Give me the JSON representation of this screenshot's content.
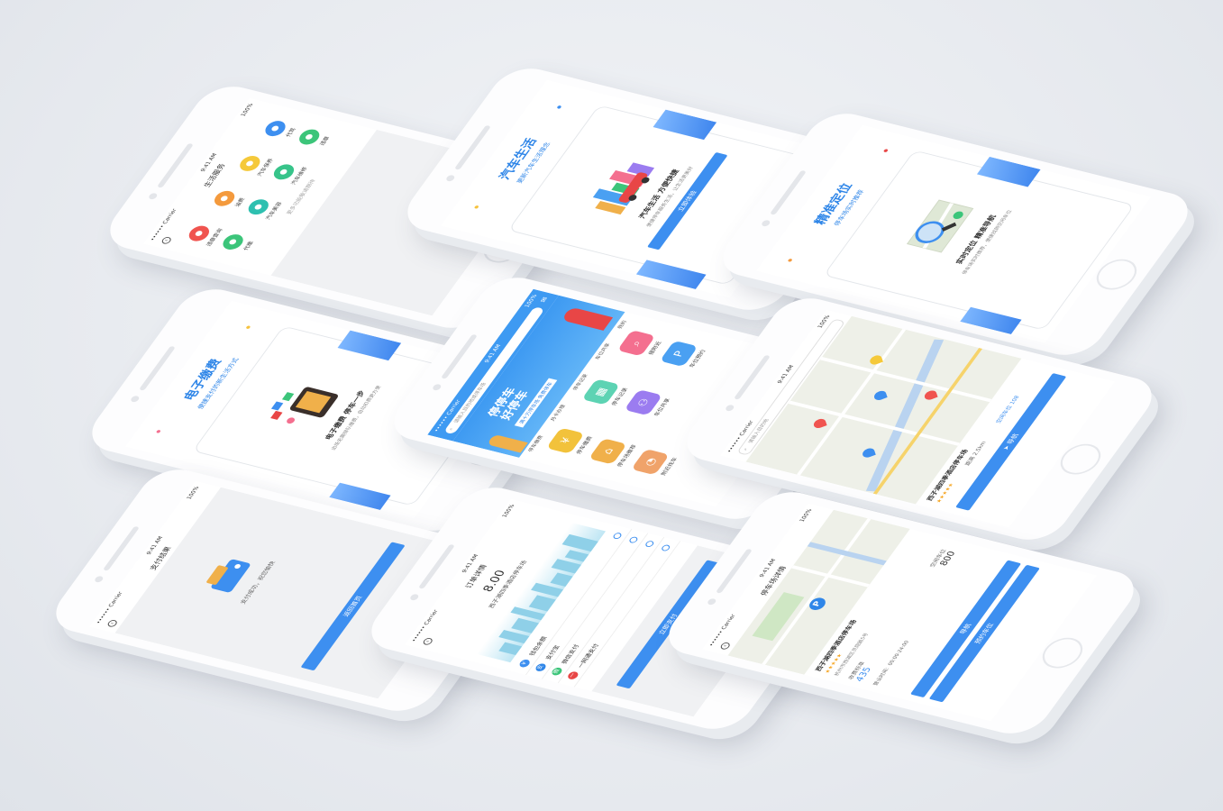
{
  "status": {
    "carrier": "•••••• Carrier",
    "time": "9:41 AM",
    "battery": "100%"
  },
  "phones": {
    "services": {
      "title": "生活服务",
      "icons": [
        {
          "label": "违章查询",
          "color": "#f0544f",
          "glyph": "●"
        },
        {
          "label": "油费",
          "color": "#f49a3d",
          "glyph": "●"
        },
        {
          "label": "汽车保养",
          "color": "#f5c93a",
          "glyph": "●"
        },
        {
          "label": "代驾",
          "color": "#3d8ff0",
          "glyph": "●"
        },
        {
          "label": "代缴",
          "color": "#3cc57a",
          "glyph": "●"
        },
        {
          "label": "汽车美容",
          "color": "#2ec0b0",
          "glyph": "●"
        },
        {
          "label": "汽车维修",
          "color": "#37c48a",
          "glyph": "●"
        },
        {
          "label": "违章",
          "color": "#3cc57a",
          "glyph": "●"
        }
      ],
      "footer": "更多功能敬请期待"
    },
    "car_life": {
      "title": "汽车生活",
      "sub": "更新汽车生活理念",
      "card_title": "汽车生活 方便快捷",
      "card_desc": "便捷停车服务生活，让生活更美好",
      "button": "立即体验"
    },
    "locate": {
      "title": "精准定位",
      "sub": "停车场实时推荐",
      "card_title": "实时定位 精准导航",
      "card_desc": "停车场实时推荐，便捷找到空闲车位"
    },
    "payment": {
      "title": "电子缴费",
      "sub": "便捷支付的新生活方式",
      "card_title": "电子缴费 停车一步",
      "card_desc": "出场无需排队缴费，自动扣费更方便"
    },
    "home": {
      "search_placeholder": "请输入目的地或停车场",
      "banner_title_1": "停停车",
      "banner_title_2": "好停车",
      "banner_sub": "满十万停车场 免费停车",
      "nav_items": [
        "停车缴费",
        "月卡办理",
        "停车记录",
        "车位共享",
        "我的"
      ],
      "tiles": [
        {
          "label": "停车缴费",
          "color": "#f2c23b",
          "glyph": "¥"
        },
        {
          "label": "停车记录",
          "color": "#5dd3b3",
          "glyph": "▦"
        },
        {
          "label": "搜附近",
          "color": "#f46f8f",
          "glyph": "⌕"
        },
        {
          "label": "停车场推荐",
          "color": "#f0b04a",
          "glyph": "⌂"
        },
        {
          "label": "车位共享",
          "color": "#9b7cf0",
          "glyph": "⚇"
        },
        {
          "label": "车位预约",
          "color": "#4aa0f2",
          "glyph": "P"
        },
        {
          "label": "附近找车",
          "color": "#f0a36a",
          "glyph": "◔"
        }
      ]
    },
    "map": {
      "search_placeholder": "请输入目的地",
      "lot_name": "西子湖四季酒店停车场",
      "rating": "★★★★★",
      "distance": "距离 2.5km",
      "free_spots": "空闲车位 108",
      "button": "导航"
    },
    "pay_result": {
      "title": "支付结果",
      "message": "支付成功，祝您愉快",
      "button": "返回首页"
    },
    "order": {
      "title": "订单详情",
      "amount": "8.00",
      "lot": "西子湖四季酒店停车场",
      "methods": [
        {
          "label": "钱包余额",
          "color": "#3d8ff0"
        },
        {
          "label": "支付宝",
          "color": "#2f86e8"
        },
        {
          "label": "微信支付",
          "color": "#3cc57a"
        },
        {
          "label": "一网通支付",
          "color": "#e84646"
        }
      ],
      "button": "立即支付"
    },
    "lot_detail": {
      "title": "停车场详情",
      "lot": "西子湖四季酒店停车场",
      "rating": "★★★★★",
      "desc": "杭州市西湖区灵隐路5号",
      "price_label": "收费标准",
      "price_value": "435",
      "spots_label": "空闲车位",
      "spots_value": "800",
      "hours": "营业时间：00:00-24:00",
      "button_primary": "导航",
      "button_secondary": "预约车位"
    }
  }
}
